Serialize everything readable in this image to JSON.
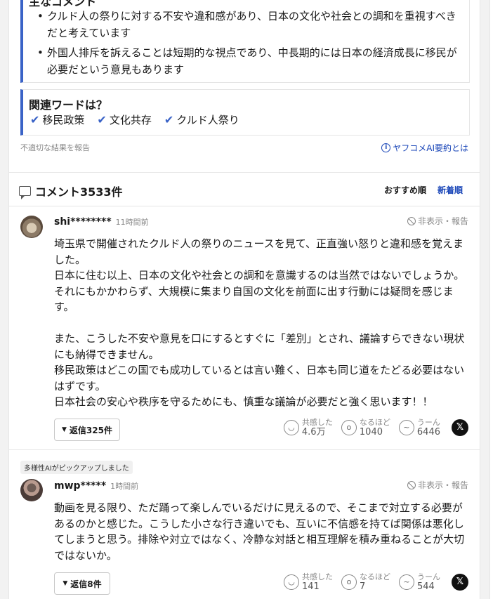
{
  "summary": {
    "heading": "主なコメント",
    "bullets": [
      "クルド人の祭りに対する不安や違和感があり、日本の文化や社会との調和を重視すべきだと考えています",
      "外国人排斥を訴えることは短期的な視点であり、中長期的には日本の経済成長に移民が必要だという意見もあります"
    ]
  },
  "related": {
    "heading": "関連ワードは？",
    "words": [
      "移民政策",
      "文化共存",
      "クルド人祭り"
    ]
  },
  "report_link": "不適切な結果を報告",
  "ai_info_link": "ヤフコメAI要約とは",
  "comments_header": {
    "title": "コメント3533件",
    "sort_recommended": "おすすめ順",
    "sort_newest": "新着順"
  },
  "comments": [
    {
      "user": "shi********",
      "time": "11時間前",
      "hide_report": "非表示・報告",
      "text": "埼玉県で開催されたクルド人の祭りのニュースを見て、正直強い怒りと違和感を覚えました。\n日本に住む以上、日本の文化や社会との調和を意識するのは当然ではないでしょうか。\nそれにもかかわらず、大規模に集まり自国の文化を前面に出す行動には疑問を感じます。\n\nまた、こうした不安や意見を口にするとすぐに「差別」とされ、議論すらできない現状にも納得できません。\n移民政策はどこの国でも成功しているとは言い難く、日本も同じ道をたどる必要はないはずです。\n日本社会の安心や秩序を守るためにも、慎重な議論が必要だと強く思います！！",
      "replies": "返信325件",
      "reactions": [
        {
          "label": "共感した",
          "count": "4.6万",
          "icon": "smile-icon"
        },
        {
          "label": "なるほど",
          "count": "1040",
          "icon": "surprised-icon"
        },
        {
          "label": "うーん",
          "count": "6446",
          "icon": "confused-icon"
        }
      ]
    },
    {
      "badge": "多様性AIがピックアップしました",
      "user": "mwp*****",
      "time": "1時間前",
      "hide_report": "非表示・報告",
      "text": "動画を見る限り、ただ踊って楽しんでいるだけに見えるので、そこまで対立する必要があるのかと感じた。こうした小さな行き違いでも、互いに不信感を持てば関係は悪化してしまうと思う。排除や対立ではなく、冷静な対話と相互理解を積み重ねることが大切ではないか。",
      "replies": "返信8件",
      "reactions": [
        {
          "label": "共感した",
          "count": "141",
          "icon": "smile-icon"
        },
        {
          "label": "なるほど",
          "count": "7",
          "icon": "surprised-icon"
        },
        {
          "label": "うーん",
          "count": "544",
          "icon": "confused-icon"
        }
      ]
    }
  ],
  "x_share": "𝕏"
}
